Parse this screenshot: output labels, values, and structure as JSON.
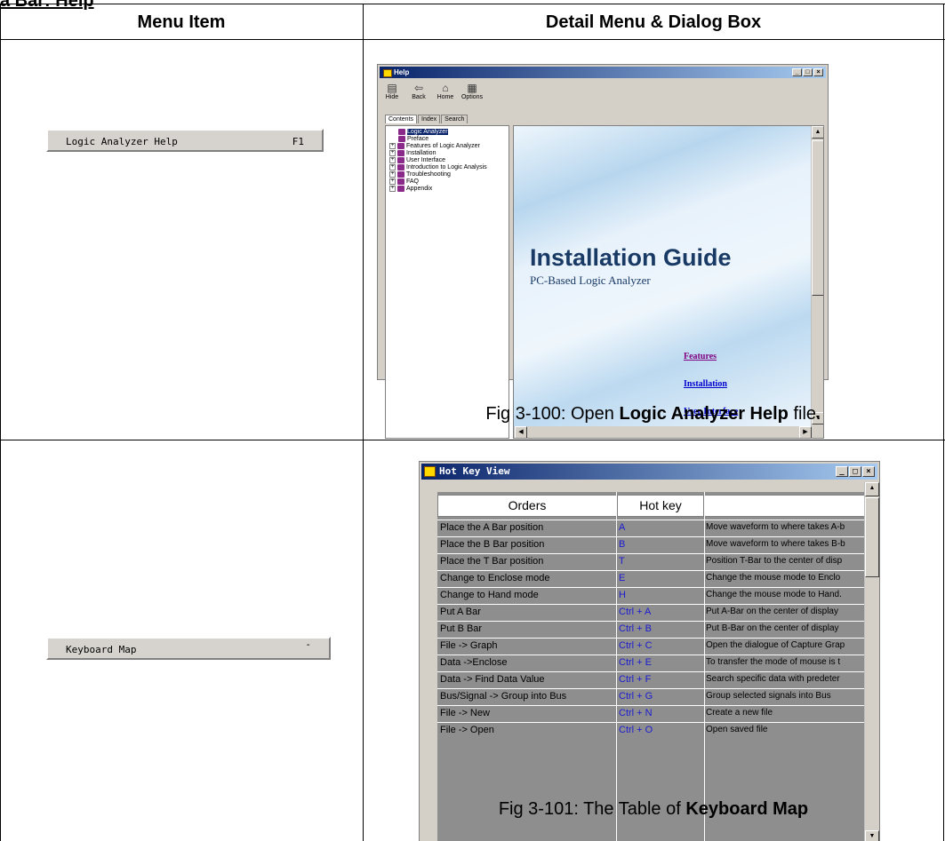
{
  "section_title": "a Bar: Help",
  "table": {
    "col1_header": "Menu Item",
    "col2_header": "Detail Menu & Dialog Box"
  },
  "row1": {
    "menu_label": "Logic Analyzer Help",
    "menu_key": "F1",
    "caption_prefix": "Fig 3-100: Open ",
    "caption_bold": "Logic Analyzer Help",
    "caption_suffix": " file."
  },
  "help_window": {
    "title": "Help",
    "toolbar": [
      {
        "label": "Hide",
        "icon": "hide-icon"
      },
      {
        "label": "Back",
        "icon": "back-icon"
      },
      {
        "label": "Home",
        "icon": "home-icon"
      },
      {
        "label": "Options",
        "icon": "options-icon"
      }
    ],
    "tabs": [
      "Contents",
      "Index",
      "Search"
    ],
    "tree": [
      {
        "label": "Logic Analyzer",
        "expander": "",
        "selected": true
      },
      {
        "label": "Preface",
        "expander": ""
      },
      {
        "label": "Features of Logic Analyzer",
        "expander": "+"
      },
      {
        "label": "Installation",
        "expander": "+"
      },
      {
        "label": "User Interface",
        "expander": "+"
      },
      {
        "label": "Introduction to Logic Analysis",
        "expander": "+"
      },
      {
        "label": "Troubleshooting",
        "expander": "+"
      },
      {
        "label": "FAQ",
        "expander": "+"
      },
      {
        "label": "Appendix",
        "expander": "+"
      }
    ],
    "content_title": "Installation Guide",
    "content_subtitle": "PC-Based Logic Analyzer",
    "links": [
      "Features",
      "Installation",
      "User Interface"
    ],
    "link_colors": {
      "visited": "#800080",
      "normal": "#0000cc"
    }
  },
  "row2": {
    "menu_label": "Keyboard Map",
    "menu_key": "-",
    "caption_prefix": "Fig 3-101: The Table of ",
    "caption_bold": "Keyboard Map"
  },
  "hotkey_window": {
    "title": "Hot Key View",
    "headers": [
      "Orders",
      "Hot key",
      ""
    ],
    "rows": [
      [
        "Place the A Bar position",
        "A",
        "Move waveform to where takes A-b"
      ],
      [
        "Place the B Bar position",
        "B",
        "Move waveform to where takes B-b"
      ],
      [
        "Place the T Bar position",
        "T",
        "Position T-Bar to the center of disp"
      ],
      [
        "Change to Enclose mode",
        "E",
        "Change the mouse mode to Enclo"
      ],
      [
        "Change to Hand mode",
        "H",
        "Change the mouse mode to Hand."
      ],
      [
        "Put A Bar",
        "Ctrl + A",
        "Put A-Bar on the center of display"
      ],
      [
        "Put B Bar",
        "Ctrl + B",
        "Put B-Bar on the center of display"
      ],
      [
        "File -> Graph",
        "Ctrl + C",
        "Open the dialogue of Capture Grap"
      ],
      [
        "Data ->Enclose",
        "Ctrl + E",
        "To transfer the mode of mouse is t"
      ],
      [
        "Data -> Find Data Value",
        "Ctrl + F",
        "Search specific data with predeter"
      ],
      [
        "Bus/Signal -> Group into Bus",
        "Ctrl + G",
        "Group selected signals into Bus"
      ],
      [
        "File -> New",
        "Ctrl + N",
        "Create a new file"
      ],
      [
        "File -> Open",
        "Ctrl + O",
        "Open saved file"
      ]
    ]
  }
}
